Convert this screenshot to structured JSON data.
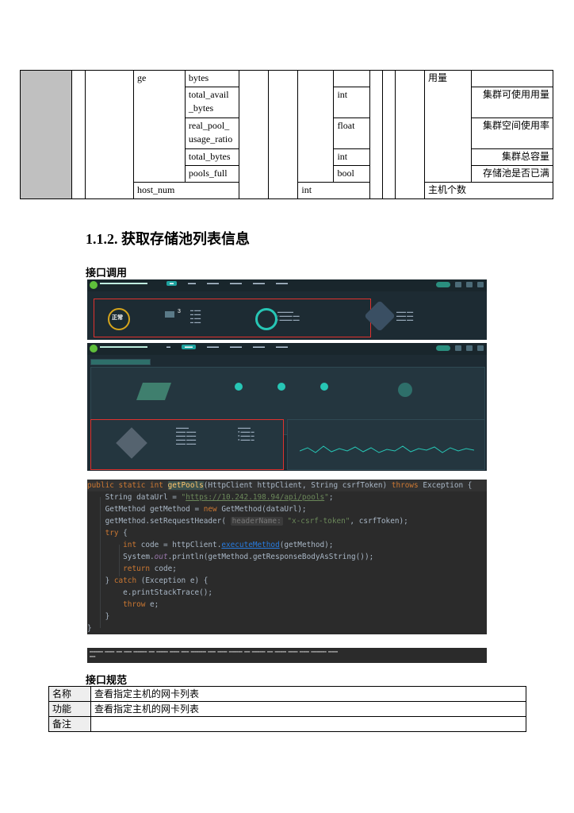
{
  "continuation_table": {
    "rows": [
      {
        "name": "ge",
        "field": "bytes",
        "type": "",
        "unit": "用量",
        "desc": ""
      },
      {
        "name": "",
        "field": "total_avail _bytes",
        "type": "int",
        "unit": "",
        "desc": "集群可使用用量"
      },
      {
        "name": "",
        "field": "real_pool_ usage_ratio",
        "type": "float",
        "unit": "",
        "desc": "集群空间使用率"
      },
      {
        "name": "",
        "field": "total_bytes",
        "type": "int",
        "unit": "",
        "desc": "集群总容量"
      },
      {
        "name": "",
        "field": "pools_full",
        "type": "bool",
        "unit": "",
        "desc": "存储池是否已满"
      }
    ],
    "last_row": {
      "name": "host_num",
      "type": "int",
      "desc": "主机个数"
    }
  },
  "section": {
    "title": "1.1.2. 获取存储池列表信息",
    "call_heading": "接口调用",
    "spec_heading": "接口规范"
  },
  "screenshot1": {
    "status": "正常"
  },
  "code": {
    "lines": [
      "public static int getPools(HttpClient httpClient, String csrfToken) throws Exception {",
      "    String dataUrl = \"https://10.242.198.94/api/pools\";",
      "    GetMethod getMethod = new GetMethod(dataUrl);",
      "    getMethod.setRequestHeader( headerName: \"x-csrf-token\", csrfToken);",
      "    try {",
      "        int code = httpClient.executeMethod(getMethod);",
      "        System.out.println(getMethod.getResponseBodyAsString());",
      "        return code;",
      "    } catch (Exception e) {",
      "        e.printStackTrace();",
      "        throw e;",
      "    }",
      "}"
    ]
  },
  "spec_table": {
    "rows": [
      {
        "key": "名称",
        "value": "查看指定主机的网卡列表"
      },
      {
        "key": "功能",
        "value": "查看指定主机的网卡列表"
      },
      {
        "key": "备注",
        "value": ""
      }
    ]
  }
}
